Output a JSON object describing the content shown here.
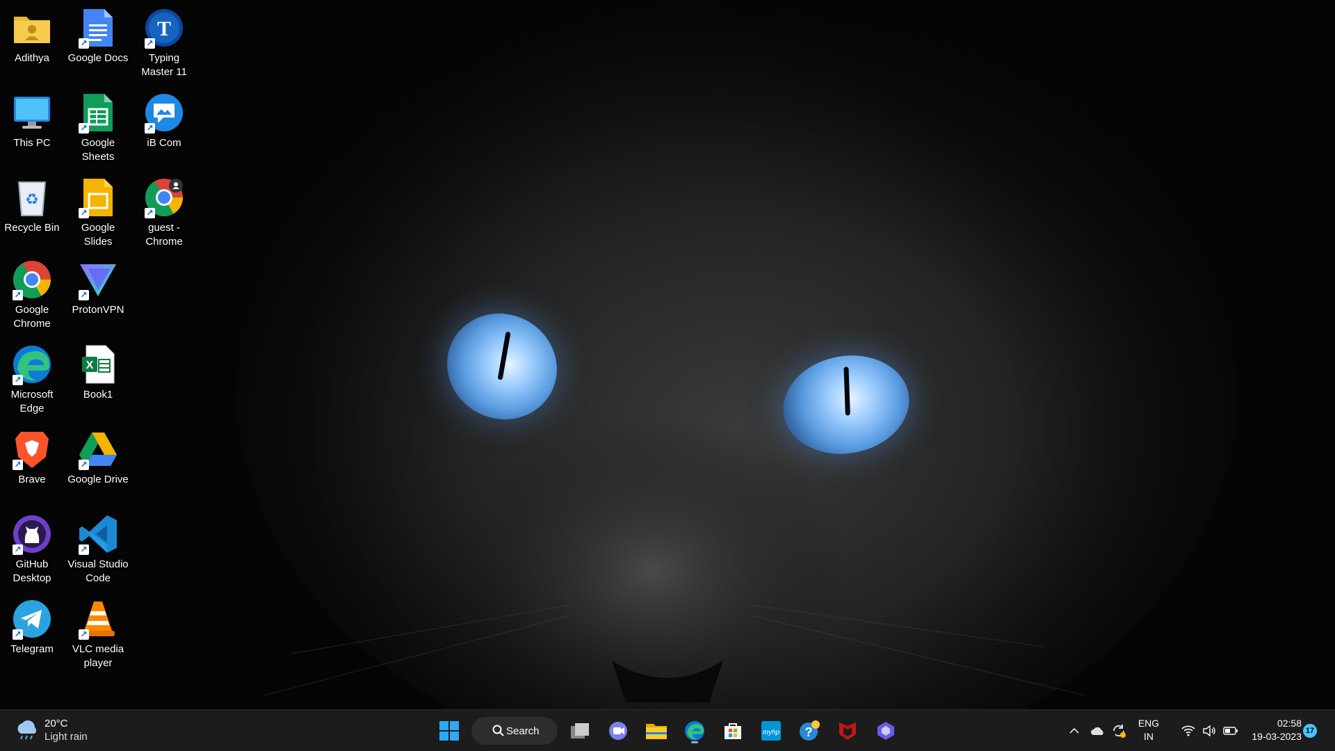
{
  "desktop": {
    "icons": [
      {
        "label": "Adithya",
        "icon": "user-folder-icon"
      },
      {
        "label": "Google Docs",
        "icon": "google-docs-icon"
      },
      {
        "label": "Typing Master 11",
        "icon": "typing-master-icon"
      },
      {
        "label": "This PC",
        "icon": "monitor-icon"
      },
      {
        "label": "Google Sheets",
        "icon": "google-sheets-icon"
      },
      {
        "label": "iB Com",
        "icon": "chat-image-icon"
      },
      {
        "label": "Recycle Bin",
        "icon": "recycle-bin-icon"
      },
      {
        "label": "Google Slides",
        "icon": "google-slides-icon"
      },
      {
        "label": "guest - Chrome",
        "icon": "chrome-profile-icon"
      },
      {
        "label": "Google Chrome",
        "icon": "chrome-icon"
      },
      {
        "label": "ProtonVPN",
        "icon": "protonvpn-icon"
      },
      {
        "label": "Microsoft Edge",
        "icon": "edge-icon"
      },
      {
        "label": "Book1",
        "icon": "excel-file-icon"
      },
      {
        "label": "Brave",
        "icon": "brave-icon"
      },
      {
        "label": "Google Drive",
        "icon": "google-drive-icon"
      },
      {
        "label": "GitHub Desktop",
        "icon": "github-icon"
      },
      {
        "label": "Visual Studio Code",
        "icon": "vscode-icon"
      },
      {
        "label": "Telegram",
        "icon": "telegram-icon"
      },
      {
        "label": "VLC media player",
        "icon": "vlc-icon"
      }
    ]
  },
  "taskbar": {
    "weather": {
      "temp": "20°C",
      "condition": "Light rain"
    },
    "search_label": "Search",
    "pinned": [
      "start-icon",
      "task-view-icon",
      "teams-chat-icon",
      "file-explorer-icon",
      "edge-icon",
      "microsoft-store-icon",
      "myhp-icon",
      "get-help-icon",
      "mcafee-icon",
      "copilot-icon"
    ],
    "tray": {
      "lang_top": "ENG",
      "lang_bottom": "IN",
      "time": "02:58",
      "date": "19-03-2023",
      "notification_count": "17"
    }
  },
  "colors": {
    "taskbar_bg": "#1c1c1c",
    "eye_blue": "#9fcfff",
    "accent": "#0078d4"
  }
}
